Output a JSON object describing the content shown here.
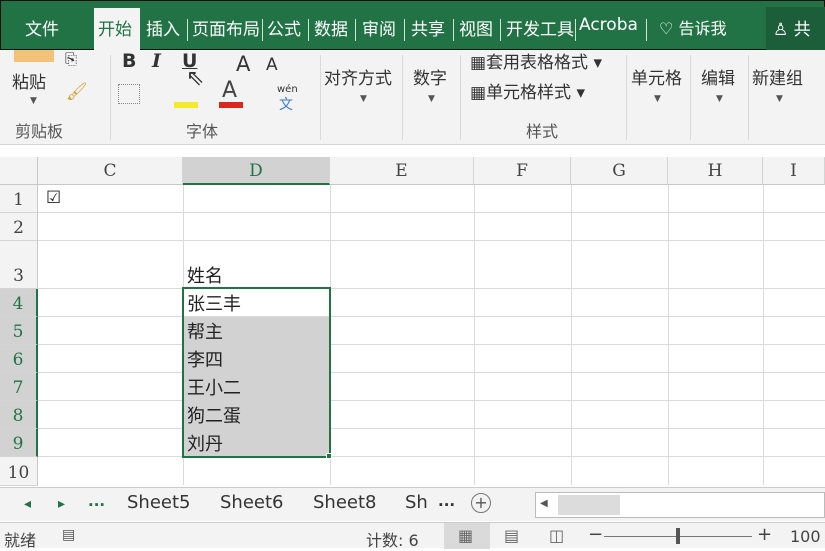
{
  "tabs": [
    "文件",
    "开始",
    "插入",
    "页面布局",
    "公式",
    "数据",
    "审阅",
    "共享",
    "视图",
    "开发工具",
    "Acroba",
    "告诉我",
    "共"
  ],
  "ribbon": {
    "paste": "粘贴",
    "clipboard": "剪贴板",
    "bold": "B",
    "italic": "I",
    "underline": "U",
    "grow": "A",
    "shrink": "A",
    "wen": "wén",
    "wen_char": "文",
    "font_group": "字体",
    "align": "对齐方式",
    "number": "数字",
    "table_format": "套用表格格式",
    "cell_style": "单元格样式",
    "styles": "样式",
    "cells": "单元格",
    "edit": "编辑",
    "newgroup": "新建组"
  },
  "columns": [
    "C",
    "D",
    "E",
    "F",
    "G",
    "H",
    "I"
  ],
  "rows": [
    "1",
    "2",
    "3",
    "4",
    "5",
    "6",
    "7",
    "8",
    "9",
    "10"
  ],
  "checkbox": "☑",
  "cells": {
    "d3": "姓名",
    "d4": "张三丰",
    "d5": "帮主",
    "d6": "李四",
    "d7": "王小二",
    "d8": "狗二蛋",
    "d9": "刘丹"
  },
  "sheets": {
    "more": "...",
    "tabs": [
      "Sheet5",
      "Sheet6",
      "Sheet8",
      "Sh"
    ],
    "more2": "..."
  },
  "status": {
    "ready": "就绪",
    "count": "计数: 6",
    "zoom": "100"
  }
}
